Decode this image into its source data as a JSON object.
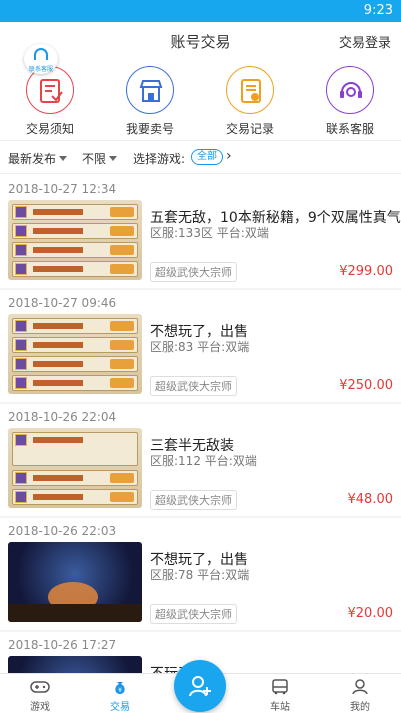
{
  "status": {
    "time": "9:23"
  },
  "header": {
    "title": "账号交易",
    "login": "交易登录"
  },
  "cs_badge": {
    "label": "联系客服"
  },
  "menu": [
    {
      "label": "交易须知",
      "icon": "notice-icon",
      "color": "#e5454a"
    },
    {
      "label": "我要卖号",
      "icon": "shop-icon",
      "color": "#3b6fd6"
    },
    {
      "label": "交易记录",
      "icon": "record-icon",
      "color": "#f0a020"
    },
    {
      "label": "联系客服",
      "icon": "support-icon",
      "color": "#8a3fd1"
    }
  ],
  "filter": {
    "sort": "最新发布",
    "limit": "不限",
    "choose_game": "选择游戏:",
    "all": "全部"
  },
  "listings": [
    {
      "date": "2018-10-27 12:34",
      "title": "五套无敌，10本新秘籍，9个双属性真气",
      "area": "区服:133区",
      "platform": "平台:双端",
      "game": "超级武侠大宗师",
      "price": "¥299.00"
    },
    {
      "date": "2018-10-27 09:46",
      "title": "不想玩了，出售",
      "area": "区服:83",
      "platform": "平台:双端",
      "game": "超级武侠大宗师",
      "price": "¥250.00"
    },
    {
      "date": "2018-10-26 22:04",
      "title": "三套半无敌装",
      "area": "区服:112",
      "platform": "平台:双端",
      "game": "超级武侠大宗师",
      "price": "¥48.00"
    },
    {
      "date": "2018-10-26 22:03",
      "title": "不想玩了，出售",
      "area": "区服:78",
      "platform": "平台:双端",
      "game": "超级武侠大宗师",
      "price": "¥20.00"
    },
    {
      "date": "2018-10-26 17:27",
      "title": "不玩了",
      "area": "",
      "platform": "",
      "game": "",
      "price": ""
    }
  ],
  "tabs": [
    {
      "label": "游戏",
      "icon": "gamepad-icon"
    },
    {
      "label": "交易",
      "icon": "money-bag-icon",
      "active": true
    },
    {
      "label": "车站",
      "icon": "bus-icon"
    },
    {
      "label": "我的",
      "icon": "user-icon"
    }
  ],
  "colors": {
    "accent": "#1b97e6",
    "price": "#e53935",
    "statusbar": "#16a7ef"
  }
}
